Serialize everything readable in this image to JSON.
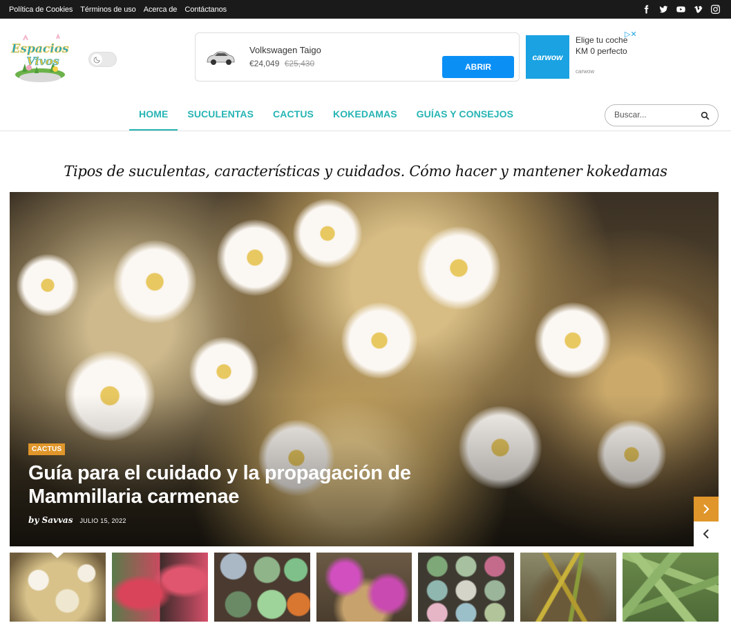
{
  "topbar": {
    "links": [
      "Política de Cookies",
      "Términos de uso",
      "Acerca de",
      "Contáctanos"
    ],
    "social_icons": [
      "facebook-icon",
      "twitter-icon",
      "youtube-icon",
      "vimeo-icon",
      "instagram-icon"
    ]
  },
  "header": {
    "logo_text": "Espacios Vivos",
    "dark_mode_toggle": "moon-icon"
  },
  "ad": {
    "title": "Volkswagen Taigo",
    "price": "€24,049",
    "old_price": "€25,430",
    "button": "ABRIR",
    "brand": "carwow",
    "text": "Elige tu coche KM 0 perfecto",
    "brand_small": "carwow"
  },
  "nav": {
    "items": [
      "HOME",
      "SUCULENTAS",
      "CACTUS",
      "KOKEDAMAS",
      "GUÍAS Y CONSEJOS"
    ],
    "active": "HOME",
    "search_placeholder": "Buscar..."
  },
  "tagline": "Tipos de suculentas, características y cuidados. Cómo hacer y mantener kokedamas",
  "hero": {
    "category": "CACTUS",
    "title": "Guía para el cuidado y la propagación de Mammillaria carmenae",
    "author": "by Savvas",
    "date": "JULIO 15, 2022"
  },
  "colors": {
    "accent": "#26b4b4",
    "badge": "#e0962a",
    "topbar": "#1a1a1a",
    "ad_button": "#0a8ff5"
  }
}
